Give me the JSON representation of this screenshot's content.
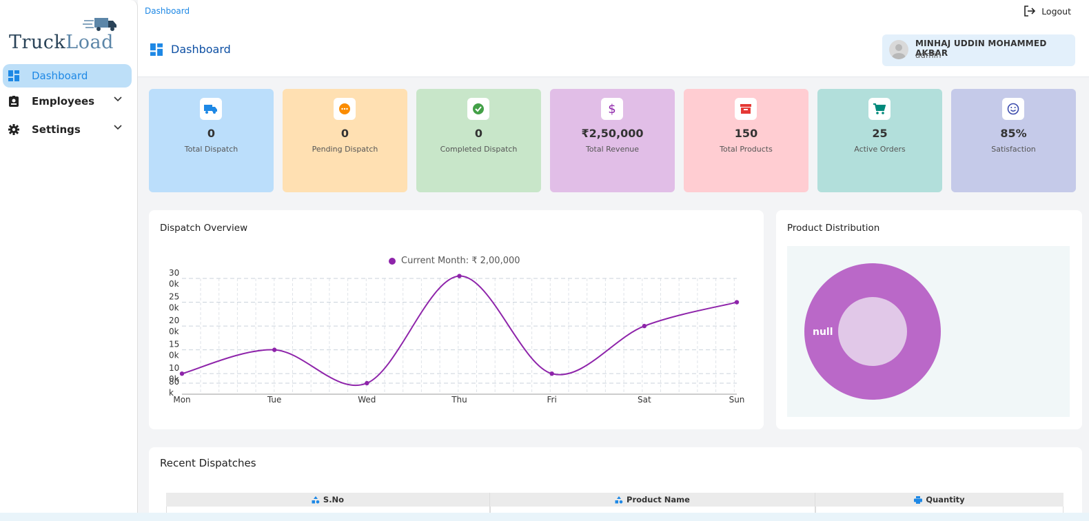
{
  "brand": {
    "part1": "Truck",
    "part2": "Load"
  },
  "sidebar": {
    "items": [
      {
        "label": "Dashboard",
        "icon": "dashboard-icon",
        "active": true
      },
      {
        "label": "Employees",
        "icon": "id-badge-icon",
        "expandable": true
      },
      {
        "label": "Settings",
        "icon": "gear-icon",
        "expandable": true
      }
    ]
  },
  "header": {
    "breadcrumb": "Dashboard",
    "logout_label": "Logout",
    "page_title": "Dashboard",
    "user_name": "MINHAJ UDDIN MOHAMMED AKBAR",
    "user_role": "admin"
  },
  "stats": [
    {
      "value": "0",
      "label": "Total Dispatch",
      "icon": "truck-icon",
      "bg": "#bbdefb",
      "color": "#1e88e5"
    },
    {
      "value": "0",
      "label": "Pending Dispatch",
      "icon": "pending-icon",
      "bg": "#ffe0b2",
      "color": "#fb8c00"
    },
    {
      "value": "0",
      "label": "Completed Dispatch",
      "icon": "check-circle-icon",
      "bg": "#c8e6c9",
      "color": "#43a047"
    },
    {
      "value": "₹2,50,000",
      "label": "Total Revenue",
      "icon": "dollar-icon",
      "bg": "#e1bee7",
      "color": "#8e24aa"
    },
    {
      "value": "150",
      "label": "Total Products",
      "icon": "archive-icon",
      "bg": "#ffcdd2",
      "color": "#e53935"
    },
    {
      "value": "25",
      "label": "Active Orders",
      "icon": "cart-icon",
      "bg": "#b2dfdb",
      "color": "#00897b"
    },
    {
      "value": "85%",
      "label": "Satisfaction",
      "icon": "smile-icon",
      "bg": "#c5cae9",
      "color": "#3949ab"
    }
  ],
  "dispatch_panel": {
    "title": "Dispatch Overview"
  },
  "product_panel": {
    "title": "Product Distribution"
  },
  "recent_panel": {
    "title": "Recent Dispatches",
    "columns": [
      {
        "label": "S.No",
        "icon": "sort-shapes-icon"
      },
      {
        "label": "Product Name",
        "icon": "sort-shapes-icon"
      },
      {
        "label": "Quantity",
        "icon": "printer-icon"
      }
    ]
  },
  "chart_data": [
    {
      "type": "line",
      "title": "Dispatch Overview",
      "categories": [
        "Mon",
        "Tue",
        "Wed",
        "Thu",
        "Fri",
        "Sat",
        "Sun"
      ],
      "series": [
        {
          "name": "Current Month: ₹ 2,00,000",
          "values": [
            100000,
            150000,
            80000,
            305000,
            100000,
            200000,
            250000
          ],
          "color": "#8e24aa"
        }
      ],
      "y_ticks": [
        "30\n0k",
        "25\n0k",
        "20\n0k",
        "15\n0k",
        "10\n0k",
        "80\nk"
      ],
      "ylim": [
        80000,
        300000
      ],
      "grid": true,
      "legend": "top-center"
    },
    {
      "type": "pie",
      "title": "Product Distribution",
      "labels": [
        "null"
      ],
      "values": [
        1
      ],
      "colors": [
        "#ba68c8"
      ]
    }
  ]
}
